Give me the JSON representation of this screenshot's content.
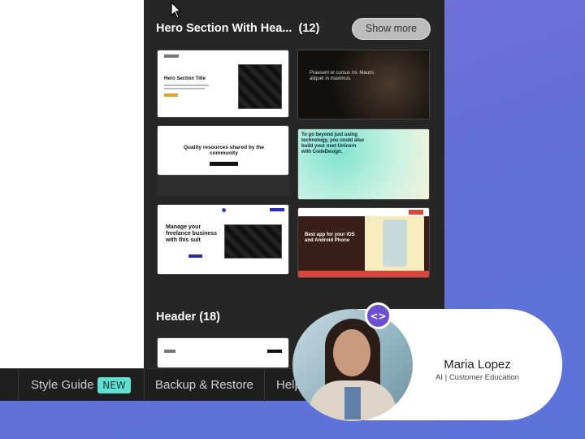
{
  "sections": [
    {
      "title": "Hero Section With Hea...",
      "count": "(12)",
      "show_more": "Show more"
    },
    {
      "title": "Header",
      "count": "(18)"
    }
  ],
  "thumbnails": {
    "hero1_title": "Hero Section Title",
    "hero3_title": "Quality resources shared by the community",
    "hero4_text": "To go beyond just using technology, you could also build your next Unicorn with CodeDesign.",
    "hero5_title": "Manage your freelance business with this suit",
    "hero6_title": "Best app for your iOS and Android Phone"
  },
  "bottom_bar": {
    "style_guide": "Style Guide",
    "new_badge": "NEW",
    "backup": "Backup & Restore",
    "help": "Help"
  },
  "profile": {
    "name": "Maria Lopez",
    "role": "AI | Customer Education"
  },
  "colors": {
    "panel": "#262626",
    "badge": "#5fe0d3",
    "accent": "#6b4fd0"
  }
}
